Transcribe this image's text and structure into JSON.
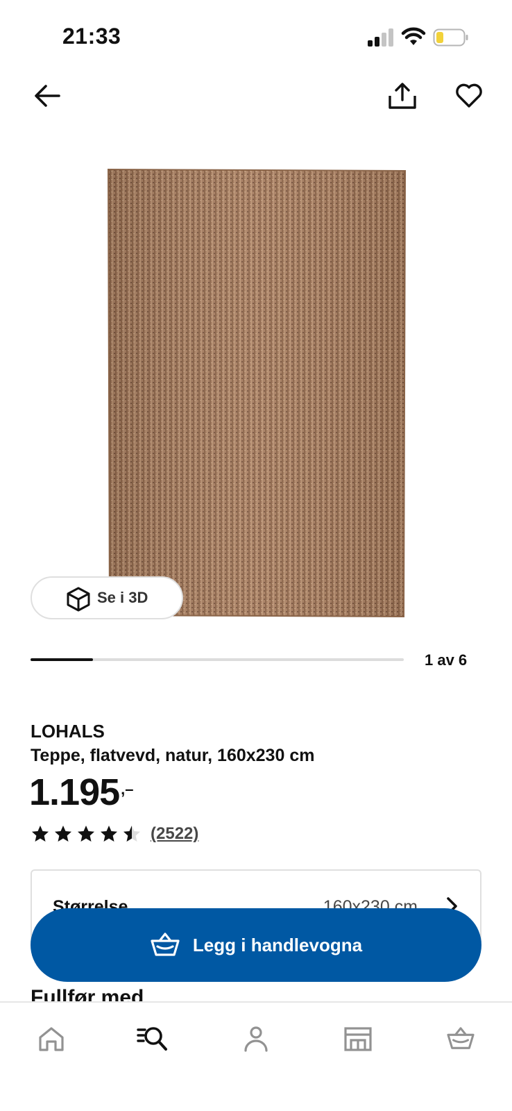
{
  "status_bar": {
    "time": "21:33",
    "icons": [
      "cellular-signal-icon",
      "wifi-icon",
      "battery-low-icon"
    ]
  },
  "header": {
    "back_icon": "arrow-left-icon",
    "share_icon": "share-icon",
    "favorite_icon": "heart-icon"
  },
  "gallery": {
    "view_3d_label": "Se i 3D",
    "pager_label": "1 av 6",
    "current_index": 1,
    "total": 6
  },
  "product": {
    "name": "LOHALS",
    "description": "Teppe, flatvevd, natur, 160x230 cm",
    "price": "1.195",
    "price_suffix": ",–",
    "rating": 4.5,
    "rating_max": 5,
    "review_count": "(2522)"
  },
  "size_selector": {
    "label": "Størrelse",
    "value": "160x230 cm"
  },
  "next_section_heading": "Fullfør med",
  "cart_button": {
    "label": "Legg i handlevogna",
    "icon": "basket-icon"
  },
  "bottom_nav": {
    "items": [
      {
        "icon": "home-icon",
        "active": false
      },
      {
        "icon": "search-list-icon",
        "active": true
      },
      {
        "icon": "profile-icon",
        "active": false
      },
      {
        "icon": "store-icon",
        "active": false
      },
      {
        "icon": "basket-icon",
        "active": false
      }
    ]
  },
  "colors": {
    "primary_blue": "#0058a3",
    "text": "#111111",
    "muted_icon": "#929292",
    "rug_base": "#a87f62"
  }
}
